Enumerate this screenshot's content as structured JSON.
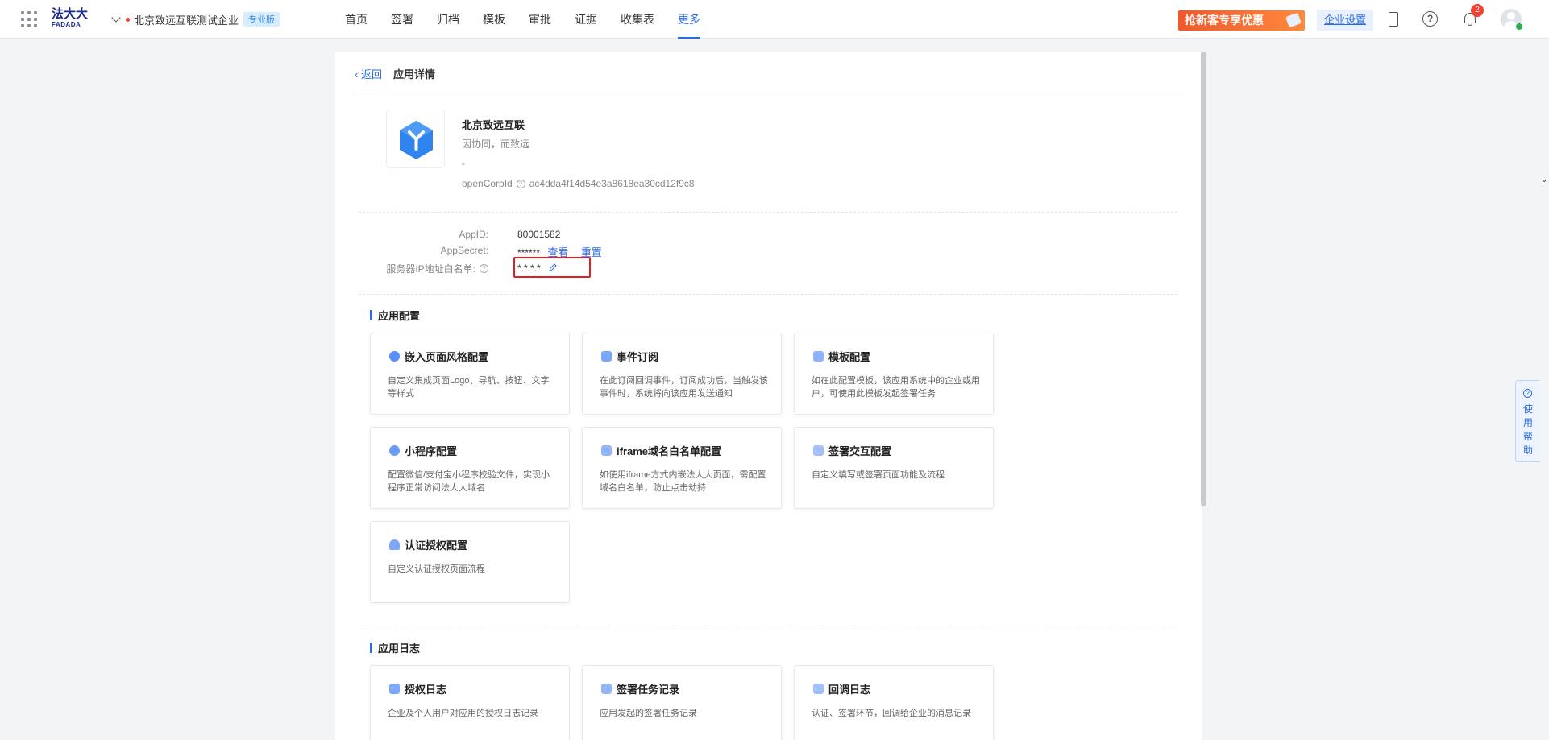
{
  "header": {
    "logo_cn": "法大大",
    "logo_en": "FADADA",
    "org_name": "北京致远互联测试企业",
    "org_badge": "专业版",
    "nav": [
      "首页",
      "签署",
      "归档",
      "模板",
      "审批",
      "证据",
      "收集表",
      "更多"
    ],
    "active_nav": "更多",
    "promo": "抢新客专享优惠",
    "corp_settings": "企业设置",
    "notification_count": "2"
  },
  "breadcrumb": {
    "back": "返回",
    "title": "应用详情"
  },
  "app": {
    "name": "北京致远互联",
    "slogan": "因协同，而致远",
    "dash": "-",
    "open_corp_label": "openCorpId",
    "open_corp_value": "ac4dda4f14d54e3a8618ea30cd12f9c8"
  },
  "credentials": {
    "appid_label": "AppID:",
    "appid_value": "80001582",
    "secret_label": "AppSecret:",
    "secret_value": "******",
    "view": "查看",
    "reset": "重置",
    "ip_label": "服务器IP地址白名单:",
    "ip_value": "*.*.*.*"
  },
  "config_section": {
    "title": "应用配置",
    "tiles": [
      {
        "title": "嵌入页面风格配置",
        "desc": "自定义集成页面Logo、导航、按钮、文字等样式",
        "icon": "palette-icon"
      },
      {
        "title": "事件订阅",
        "desc": "在此订阅回调事件，订阅成功后，当触发该事件时，系统将向该应用发送通知",
        "icon": "event-icon"
      },
      {
        "title": "模板配置",
        "desc": "如在此配置模板，该应用系统中的企业或用户，可使用此模板发起签署任务",
        "icon": "template-icon"
      },
      {
        "title": "小程序配置",
        "desc": "配置微信/支付宝小程序校验文件，实现小程序正常访问法大大域名",
        "icon": "miniprogram-icon"
      },
      {
        "title": "iframe域名白名单配置",
        "desc": "如使用iframe方式内嵌法大大页面，需配置域名白名单，防止点击劫持",
        "icon": "iframe-icon"
      },
      {
        "title": "签署交互配置",
        "desc": "自定义填写或签署页面功能及流程",
        "icon": "sign-interact-icon"
      },
      {
        "title": "认证授权配置",
        "desc": "自定义认证授权页面流程",
        "icon": "auth-icon"
      }
    ]
  },
  "log_section": {
    "title": "应用日志",
    "tiles": [
      {
        "title": "授权日志",
        "desc": "企业及个人用户对应用的授权日志记录",
        "icon": "auth-log-icon"
      },
      {
        "title": "签署任务记录",
        "desc": "应用发起的签署任务记录",
        "icon": "sign-task-icon"
      },
      {
        "title": "回调日志",
        "desc": "认证、签署环节，回调给企业的消息记录",
        "icon": "callback-log-icon"
      }
    ]
  },
  "help_tab": "使用帮助",
  "colors": {
    "accent": "#2b6be6",
    "highlight": "#e02020",
    "promo": "#f0582a"
  }
}
